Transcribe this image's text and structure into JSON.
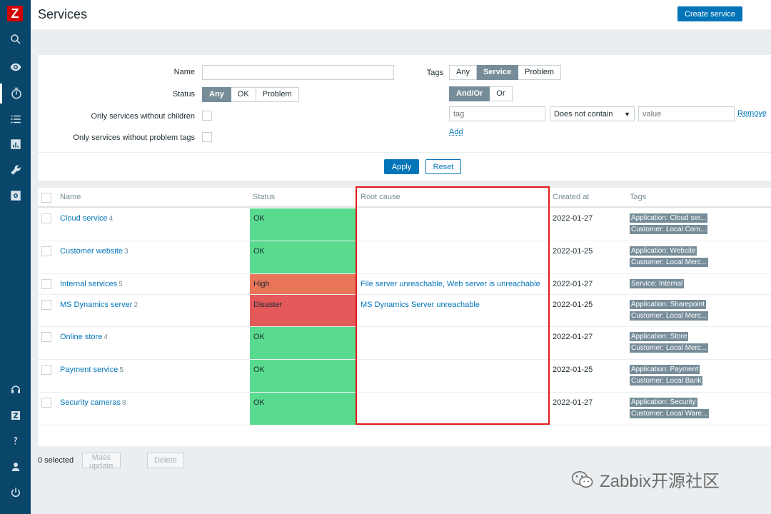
{
  "app": {
    "logo_letter": "Z",
    "page_title": "Services",
    "create_button": "Create service"
  },
  "sidebar": {
    "icons": [
      "search-icon",
      "eye-icon",
      "stopwatch-icon",
      "list-icon",
      "chart-icon",
      "wrench-icon",
      "gear-icon",
      "headset-icon",
      "zabbix-icon",
      "help-icon",
      "user-icon",
      "power-icon"
    ],
    "active": "stopwatch-icon"
  },
  "filter": {
    "name_label": "Name",
    "name_value": "",
    "status_label": "Status",
    "status_options": [
      "Any",
      "OK",
      "Problem"
    ],
    "status_selected": "Any",
    "no_children_label": "Only services without children",
    "no_problem_tags_label": "Only services without problem tags",
    "tags_label": "Tags",
    "tags_options": [
      "Any",
      "Service",
      "Problem"
    ],
    "tags_selected": "Service",
    "andor_options": [
      "And/Or",
      "Or"
    ],
    "andor_selected": "And/Or",
    "tag_placeholder": "tag",
    "operator_value": "Does not contain",
    "value_placeholder": "value",
    "remove_link": "Remove",
    "add_link": "Add",
    "apply_button": "Apply",
    "reset_button": "Reset"
  },
  "table": {
    "headers": {
      "name": "Name",
      "status": "Status",
      "root_cause": "Root cause",
      "created_at": "Created at",
      "tags": "Tags"
    },
    "rows": [
      {
        "name": "Cloud service",
        "count": "4",
        "status": "OK",
        "root_cause": "",
        "created": "2022-01-27",
        "tags": [
          "Application: Cloud ser...",
          "Customer: Local Com..."
        ]
      },
      {
        "name": "Customer website",
        "count": "3",
        "status": "OK",
        "root_cause": "",
        "created": "2022-01-25",
        "tags": [
          "Application: Website",
          "Customer: Local Merc..."
        ]
      },
      {
        "name": "Internal services",
        "count": "5",
        "status": "High",
        "root_cause": "File server unreachable, Web server is unreachable",
        "created": "2022-01-27",
        "tags": [
          "Service: Internal"
        ]
      },
      {
        "name": "MS Dynamics server",
        "count": "2",
        "status": "Disaster",
        "root_cause": "MS Dynamics Server unreachable",
        "created": "2022-01-25",
        "tags": [
          "Application: Sharepoint",
          "Customer: Local Merc..."
        ]
      },
      {
        "name": "Online store",
        "count": "4",
        "status": "OK",
        "root_cause": "",
        "created": "2022-01-27",
        "tags": [
          "Application: Store",
          "Customer: Local Merc..."
        ]
      },
      {
        "name": "Payment service",
        "count": "5",
        "status": "OK",
        "root_cause": "",
        "created": "2022-01-25",
        "tags": [
          "Application: Payment",
          "Customer: Local Bank"
        ]
      },
      {
        "name": "Security cameras",
        "count": "8",
        "status": "OK",
        "root_cause": "",
        "created": "2022-01-27",
        "tags": [
          "Application: Security",
          "Customer: Local Ware..."
        ]
      }
    ]
  },
  "footer": {
    "selected_text": "0 selected",
    "mass_update": "Mass update",
    "delete": "Delete"
  },
  "watermark": {
    "text": "Zabbix开源社区"
  },
  "colors": {
    "ok": "#59db8f",
    "high": "#e97659",
    "disaster": "#e45959",
    "accent": "#0275b8",
    "sidebar": "#0a466a"
  }
}
